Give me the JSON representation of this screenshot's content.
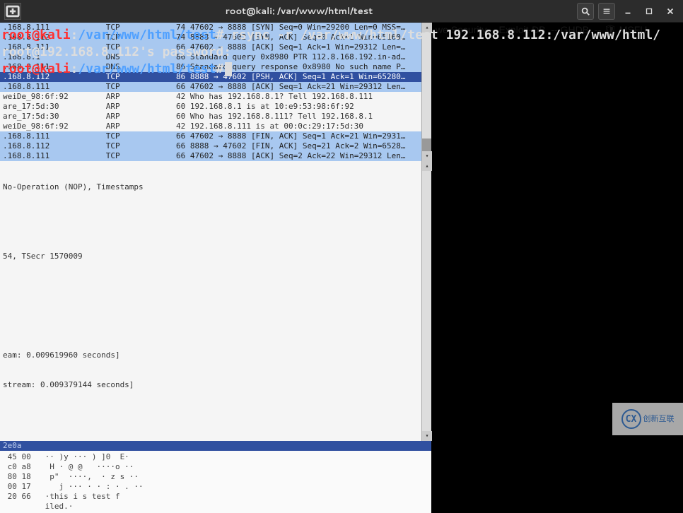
{
  "titlebar": {
    "title": "root@kali: /var/www/html/test"
  },
  "terminal": {
    "prompt1_user": "root@kali",
    "prompt1_colon": ":",
    "prompt1_path": "/var/www/html/test",
    "prompt1_hash": "#",
    "cmd1": " rsync -r /var/www/html/test 192.168.8.112:/var/www/html/",
    "line2": "root@192.168.8.112's password:",
    "prompt3_user": "root@kali",
    "prompt3_colon": ":",
    "prompt3_path": "/var/www/html/test",
    "prompt3_hash": "#"
  },
  "bg_packets": [
    {
      "cls": "blue",
      "text": ".168.8.111            TCP            74 47602 → 8888 [SYN] Seq=0 Win=29200 Len=0 MSS=…"
    },
    {
      "cls": "blue",
      "text": ".168.8.112            TCP            74 8888 → 47602 [SYN, ACK] Seq=0 Ack=1 Win=65160…"
    },
    {
      "cls": "blue",
      "text": ".168.8.111            TCP            66 47602 → 8888 [ACK] Seq=1 Ack=1 Win=29312 Len=…"
    },
    {
      "cls": "blue",
      "text": ".168.8.1              DNS            86 Standard query 0x8980 PTR 112.8.168.192.in-ad…"
    },
    {
      "cls": "blue",
      "text": ".168.8.111            DNS            86 Standard query response 0x8980 No such name P…"
    },
    {
      "cls": "sel",
      "text": ".168.8.112            TCP            86 8888 → 47602 [PSH, ACK] Seq=1 Ack=1 Win=65280…"
    },
    {
      "cls": "blue",
      "text": ".168.8.111            TCP            66 47602 → 8888 [ACK] Seq=1 Ack=21 Win=29312 Len…"
    },
    {
      "cls": "light",
      "text": "weiDe_98:6f:92        ARP            42 Who has 192.168.8.1? Tell 192.168.8.111"
    },
    {
      "cls": "light",
      "text": "are_17:5d:30          ARP            60 192.168.8.1 is at 10:e9:53:98:6f:92"
    },
    {
      "cls": "light",
      "text": "are_17:5d:30          ARP            60 Who has 192.168.8.111? Tell 192.168.8.1"
    },
    {
      "cls": "light",
      "text": "weiDe_98:6f:92        ARP            42 192.168.8.111 is at 00:0c:29:17:5d:30"
    },
    {
      "cls": "blue",
      "text": ".168.8.111            TCP            66 47602 → 8888 [FIN, ACK] Seq=1 Ack=21 Win=2931…"
    },
    {
      "cls": "blue",
      "text": ".168.8.112            TCP            66 8888 → 47602 [FIN, ACK] Seq=21 Ack=2 Win=6528…"
    },
    {
      "cls": "blue",
      "text": ".168.8.111            TCP            66 47602 → 8888 [ACK] Seq=2 Ack=22 Win=29312 Len…"
    }
  ],
  "bg_detail": {
    "line1": "No-Operation (NOP), Timestamps",
    "line2": "54, TSecr 1570009",
    "line3": "eam: 0.009619960 seconds]",
    "line4": "stream: 0.009379144 seconds]"
  },
  "bg_hexheader": "2e0a",
  "bg_hex": [
    {
      "offset": "",
      "hex": "45 00   ·· )y ··· ) ]0  E·",
      "asc": ""
    },
    {
      "offset": "",
      "hex": "c0 a8    H · @ @   ····o ··",
      "asc": ""
    },
    {
      "offset": "",
      "hex": "80 18    p\"  ····,  · z s ··",
      "asc": ""
    },
    {
      "offset": "",
      "hex": "00 17      j ··· · · : · . ··",
      "asc": ""
    },
    {
      "offset": "",
      "hex": "20 66   ·this i s test f",
      "asc": ""
    },
    {
      "offset": "",
      "hex": "        iled.·",
      "asc": ""
    }
  ],
  "right_ghost": "we Security -- Exploit-DB  -- GHDB  -- 🛡 MSFU",
  "watermark": {
    "icon": "CX",
    "text": "创新互联"
  }
}
